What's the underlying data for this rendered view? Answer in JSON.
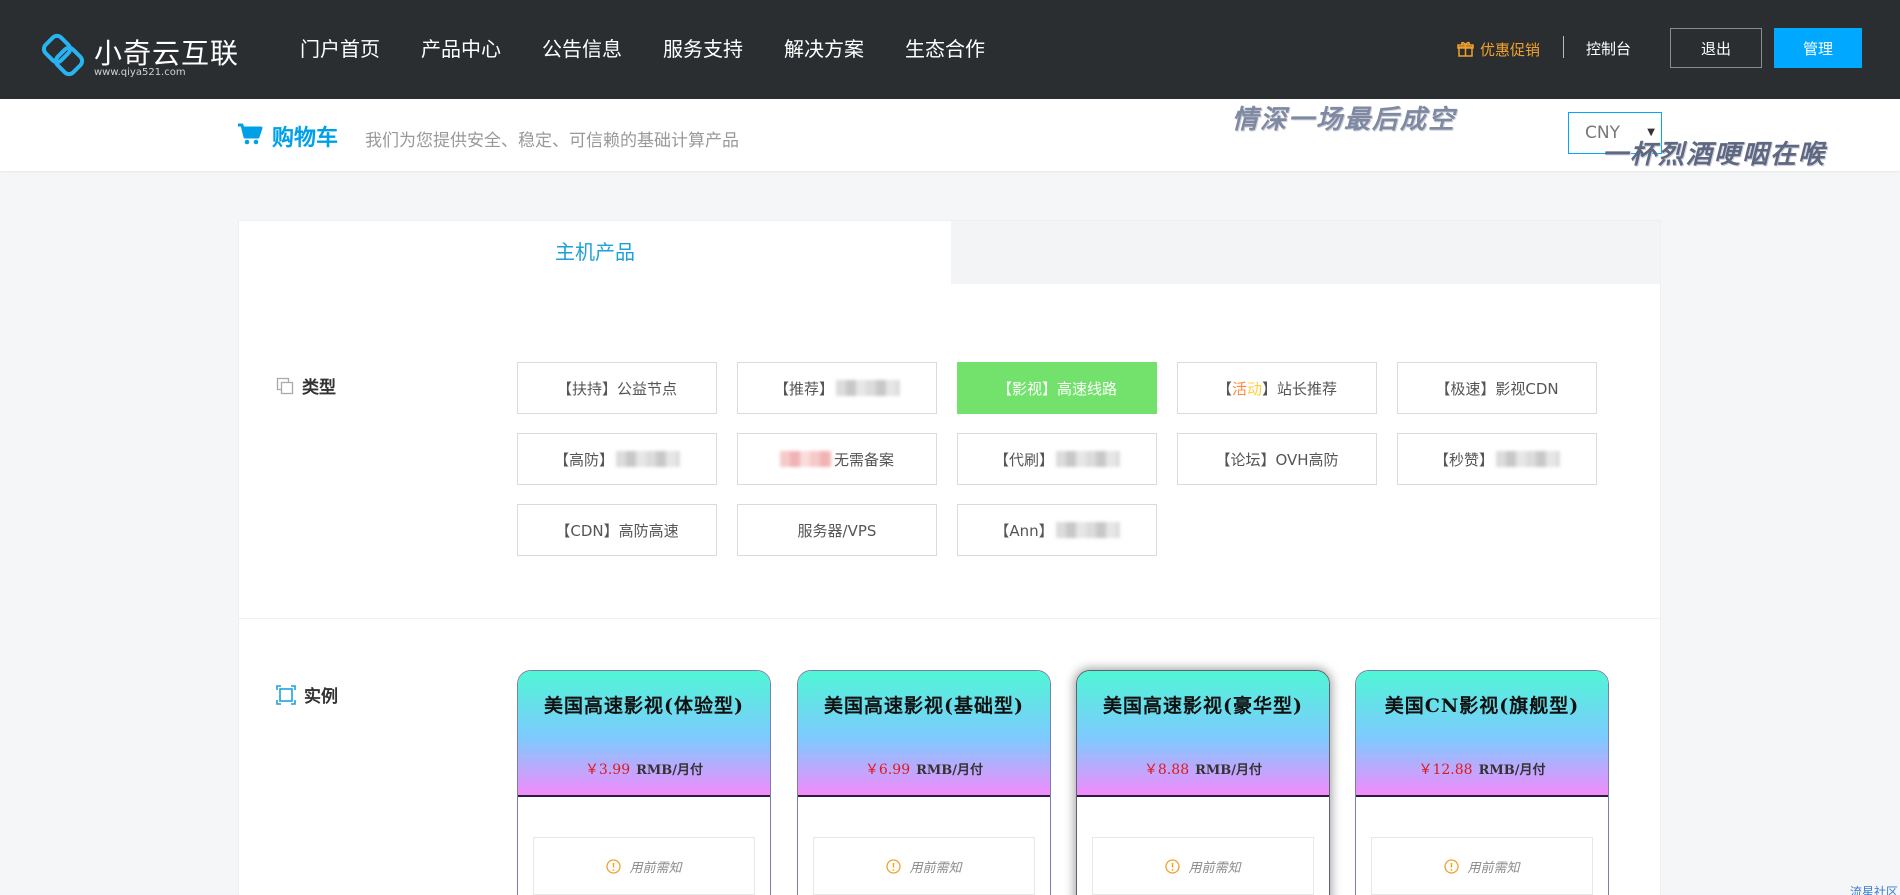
{
  "brand": {
    "name": "小奇云互联",
    "url": "www.qiya521.com"
  },
  "nav": {
    "items": [
      {
        "label": "门户首页"
      },
      {
        "label": "产品中心"
      },
      {
        "label": "公告信息"
      },
      {
        "label": "服务支持"
      },
      {
        "label": "解决方案"
      },
      {
        "label": "生态合作"
      }
    ],
    "promo": "优惠促销",
    "console": "控制台",
    "logout": "退出",
    "admin": "管理"
  },
  "subheader": {
    "title": "购物车",
    "description": "我们为您提供安全、稳定、可信赖的基础计算产品",
    "currency": "CNY",
    "overlay_line1": "情深一场最后成空",
    "overlay_line2": "一杯烈酒哽咽在喉"
  },
  "tabs": [
    {
      "label": "主机产品",
      "active": true
    }
  ],
  "type_section": {
    "label": "类型",
    "items": [
      {
        "label": "【扶持】公益节点"
      },
      {
        "label": "【推荐】",
        "blurred": true
      },
      {
        "label": "【影视】高速线路",
        "active": true
      },
      {
        "prefix": "【",
        "colored": [
          "活",
          "动"
        ],
        "suffix": "】站长推荐"
      },
      {
        "label": "【极速】影视CDN"
      },
      {
        "label": "【高防】",
        "blurred": true
      },
      {
        "label": "无需备案",
        "blurred_prefix": true
      },
      {
        "label": "【代刷】",
        "blurred": true
      },
      {
        "label": "【论坛】OVH高防"
      },
      {
        "label": "【秒赞】",
        "blurred": true
      },
      {
        "label": "【CDN】高防高速"
      },
      {
        "label": "服务器/VPS"
      },
      {
        "label": "【Ann】",
        "blurred": true
      }
    ]
  },
  "instance_section": {
    "label": "实例",
    "products": [
      {
        "name": "美国高速影视(体验型)",
        "price": "￥3.99",
        "unit": "RMB/月付",
        "notice": "用前需知"
      },
      {
        "name": "美国高速影视(基础型)",
        "price": "￥6.99",
        "unit": "RMB/月付",
        "notice": "用前需知"
      },
      {
        "name": "美国高速影视(豪华型)",
        "price": "￥8.88",
        "unit": "RMB/月付",
        "notice": "用前需知",
        "featured": true
      },
      {
        "name": "美国CN影视(旗舰型)",
        "price": "￥12.88",
        "unit": "RMB/月付",
        "notice": "用前需知"
      }
    ]
  },
  "footer_tag": "流星社区",
  "colors": {
    "header_bg": "#2b2e31",
    "accent": "#00a8ff",
    "active_type": "#73e26c",
    "price": "#e0191e",
    "promo": "#f0a12c"
  }
}
